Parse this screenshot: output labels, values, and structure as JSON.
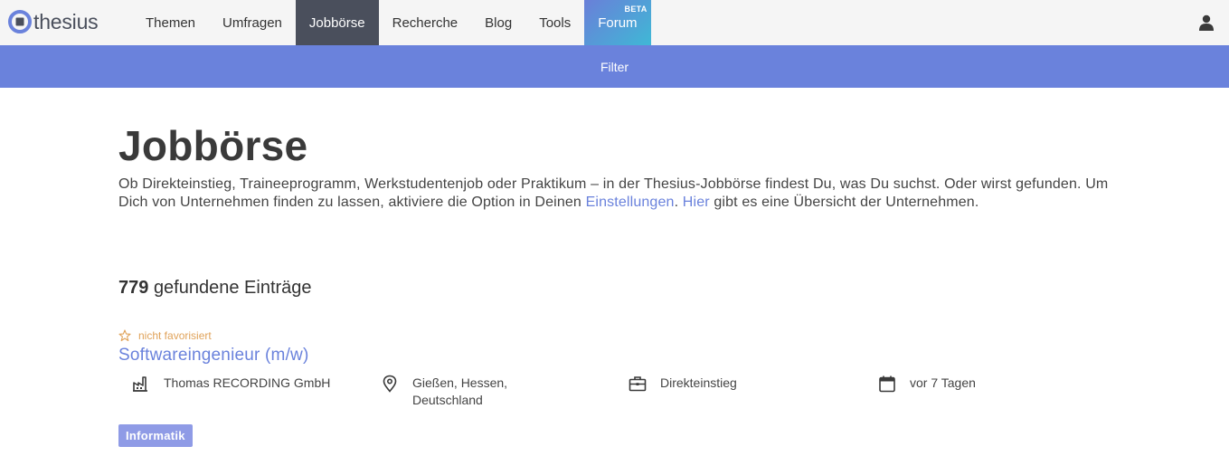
{
  "brand": {
    "name": "thesius"
  },
  "nav": {
    "items": [
      {
        "label": "Themen"
      },
      {
        "label": "Umfragen"
      },
      {
        "label": "Jobbörse"
      },
      {
        "label": "Recherche"
      },
      {
        "label": "Blog"
      },
      {
        "label": "Tools"
      },
      {
        "label": "Forum",
        "badge": "BETA"
      }
    ],
    "active": "Jobbörse"
  },
  "filter": {
    "label": "Filter"
  },
  "page": {
    "title": "Jobbörse",
    "intro_part1": "Ob Direkteinstieg, Traineeprogramm, Werkstudentenjob oder Praktikum – in der Thesius-Jobbörse findest Du, was Du suchst. Oder wirst gefunden. Um Dich von Unternehmen finden zu lassen, aktiviere die Option in Deinen ",
    "link_settings": "Einstellungen",
    "intro_part2": ". ",
    "link_here": "Hier",
    "intro_part3": " gibt es eine Übersicht der Unternehmen."
  },
  "results": {
    "count": "779",
    "label": "gefundene Einträge"
  },
  "job": {
    "favorite_label": "nicht favorisiert",
    "title": "Softwareingenieur (m/w)",
    "company": "Thomas RECORDING GmbH",
    "location_line1": "Gießen, Hessen,",
    "location_line2": "Deutschland",
    "type": "Direkteinstieg",
    "date": "vor 7 Tagen",
    "tag": "Informatik"
  },
  "colors": {
    "accent": "#6a82dc",
    "nav_active": "#4a4f5c",
    "tag": "#8f9be6",
    "favorite": "#e0a35a"
  },
  "icons": [
    "logo-icon",
    "user-icon",
    "star-icon",
    "factory-icon",
    "location-pin-icon",
    "briefcase-icon",
    "calendar-icon"
  ]
}
